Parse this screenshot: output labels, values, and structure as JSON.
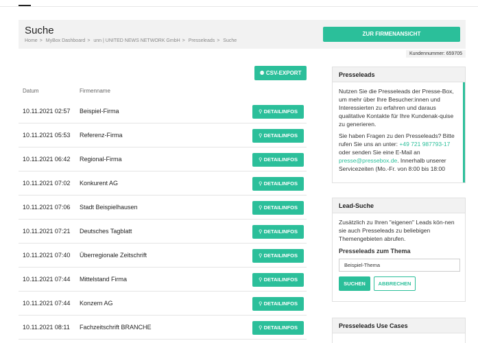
{
  "header": {
    "title": "Suche",
    "breadcrumb": [
      "Home",
      "MyBox Dashboard",
      "unn | UNITED NEWS NETWORK GmbH",
      "Presseleads",
      "Suche"
    ],
    "breadcrumb_separator": ">",
    "company_button": "ZUR FIRMENANSICHT",
    "customer_number": "Kundennummer: 659705"
  },
  "toolbar": {
    "csv_export": "CSV-EXPORT",
    "csv_icon": "people-icon"
  },
  "table": {
    "columns": [
      "Datum",
      "Firmenname"
    ],
    "detail_label": "DETAILINFOS",
    "detail_icon": "search-icon",
    "rows": [
      {
        "date": "10.11.2021 02:57",
        "firm": "Beispiel-Firma"
      },
      {
        "date": "10.11.2021 05:53",
        "firm": "Referenz-Firma"
      },
      {
        "date": "10.11.2021 06:42",
        "firm": "Regional-Firma"
      },
      {
        "date": "10.11.2021 07:02",
        "firm": "Konkurent AG"
      },
      {
        "date": "10.11.2021 07:06",
        "firm": "Stadt Beispielhausen"
      },
      {
        "date": "10.11.2021 07:21",
        "firm": "Deutsches Tagblatt"
      },
      {
        "date": "10.11.2021 07:40",
        "firm": "Überregionale Zeitschrift"
      },
      {
        "date": "10.11.2021 07:44",
        "firm": "Mittelstand Firma"
      },
      {
        "date": "10.11.2021 07:44",
        "firm": "Konzern AG"
      },
      {
        "date": "10.11.2021 08:11",
        "firm": "Fachzeitschrift BRANCHE"
      }
    ]
  },
  "sidebar": {
    "presseleads": {
      "title": "Presseleads",
      "para1": "Nutzen Sie die Presseleads der Presse-Box, um mehr über Ihre Besucher:innen und Interessierten zu erfahren und daraus qualitative Kontakte für Ihre Kundenak-quise zu generieren.",
      "para2_start": "Sie haben Fragen zu den Presseleads? Bitte rufen Sie uns an unter: ",
      "phone": "+49 721 987793-17",
      "para2_mid": " oder senden Sie eine E-Mail an ",
      "email": "presse@pressebox.de",
      "para2_end": ". Innerhalb unserer Servicezeiten (Mo.-Fr. von 8:00 bis 18:00"
    },
    "lead_search": {
      "title": "Lead-Suche",
      "text": "Zusätzlich zu Ihren \"eigenen\" Leads kön-nen sie auch Presseleads zu beliebigen Themengebieten abrufen.",
      "theme_label": "Presseleads zum Thema",
      "theme_value": "Beispiel-Thema",
      "search_button": "SUCHEN",
      "cancel_button": "ABBRECHEN"
    },
    "use_cases": {
      "title": "Presseleads Use Cases"
    }
  },
  "colors": {
    "accent": "#2bbf9a",
    "panel_bg": "#f2f2f2"
  }
}
